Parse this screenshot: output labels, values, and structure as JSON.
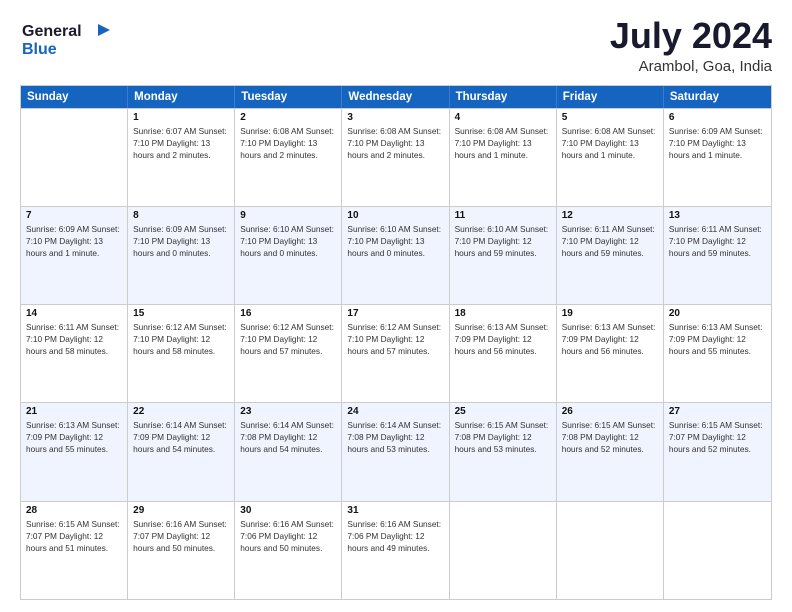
{
  "header": {
    "logo_line1": "General",
    "logo_line2": "Blue",
    "title": "July 2024",
    "subtitle": "Arambol, Goa, India"
  },
  "calendar": {
    "days": [
      "Sunday",
      "Monday",
      "Tuesday",
      "Wednesday",
      "Thursday",
      "Friday",
      "Saturday"
    ],
    "rows": [
      [
        {
          "num": "",
          "info": ""
        },
        {
          "num": "1",
          "info": "Sunrise: 6:07 AM\nSunset: 7:10 PM\nDaylight: 13 hours\nand 2 minutes."
        },
        {
          "num": "2",
          "info": "Sunrise: 6:08 AM\nSunset: 7:10 PM\nDaylight: 13 hours\nand 2 minutes."
        },
        {
          "num": "3",
          "info": "Sunrise: 6:08 AM\nSunset: 7:10 PM\nDaylight: 13 hours\nand 2 minutes."
        },
        {
          "num": "4",
          "info": "Sunrise: 6:08 AM\nSunset: 7:10 PM\nDaylight: 13 hours\nand 1 minute."
        },
        {
          "num": "5",
          "info": "Sunrise: 6:08 AM\nSunset: 7:10 PM\nDaylight: 13 hours\nand 1 minute."
        },
        {
          "num": "6",
          "info": "Sunrise: 6:09 AM\nSunset: 7:10 PM\nDaylight: 13 hours\nand 1 minute."
        }
      ],
      [
        {
          "num": "7",
          "info": "Sunrise: 6:09 AM\nSunset: 7:10 PM\nDaylight: 13 hours\nand 1 minute."
        },
        {
          "num": "8",
          "info": "Sunrise: 6:09 AM\nSunset: 7:10 PM\nDaylight: 13 hours\nand 0 minutes."
        },
        {
          "num": "9",
          "info": "Sunrise: 6:10 AM\nSunset: 7:10 PM\nDaylight: 13 hours\nand 0 minutes."
        },
        {
          "num": "10",
          "info": "Sunrise: 6:10 AM\nSunset: 7:10 PM\nDaylight: 13 hours\nand 0 minutes."
        },
        {
          "num": "11",
          "info": "Sunrise: 6:10 AM\nSunset: 7:10 PM\nDaylight: 12 hours\nand 59 minutes."
        },
        {
          "num": "12",
          "info": "Sunrise: 6:11 AM\nSunset: 7:10 PM\nDaylight: 12 hours\nand 59 minutes."
        },
        {
          "num": "13",
          "info": "Sunrise: 6:11 AM\nSunset: 7:10 PM\nDaylight: 12 hours\nand 59 minutes."
        }
      ],
      [
        {
          "num": "14",
          "info": "Sunrise: 6:11 AM\nSunset: 7:10 PM\nDaylight: 12 hours\nand 58 minutes."
        },
        {
          "num": "15",
          "info": "Sunrise: 6:12 AM\nSunset: 7:10 PM\nDaylight: 12 hours\nand 58 minutes."
        },
        {
          "num": "16",
          "info": "Sunrise: 6:12 AM\nSunset: 7:10 PM\nDaylight: 12 hours\nand 57 minutes."
        },
        {
          "num": "17",
          "info": "Sunrise: 6:12 AM\nSunset: 7:10 PM\nDaylight: 12 hours\nand 57 minutes."
        },
        {
          "num": "18",
          "info": "Sunrise: 6:13 AM\nSunset: 7:09 PM\nDaylight: 12 hours\nand 56 minutes."
        },
        {
          "num": "19",
          "info": "Sunrise: 6:13 AM\nSunset: 7:09 PM\nDaylight: 12 hours\nand 56 minutes."
        },
        {
          "num": "20",
          "info": "Sunrise: 6:13 AM\nSunset: 7:09 PM\nDaylight: 12 hours\nand 55 minutes."
        }
      ],
      [
        {
          "num": "21",
          "info": "Sunrise: 6:13 AM\nSunset: 7:09 PM\nDaylight: 12 hours\nand 55 minutes."
        },
        {
          "num": "22",
          "info": "Sunrise: 6:14 AM\nSunset: 7:09 PM\nDaylight: 12 hours\nand 54 minutes."
        },
        {
          "num": "23",
          "info": "Sunrise: 6:14 AM\nSunset: 7:08 PM\nDaylight: 12 hours\nand 54 minutes."
        },
        {
          "num": "24",
          "info": "Sunrise: 6:14 AM\nSunset: 7:08 PM\nDaylight: 12 hours\nand 53 minutes."
        },
        {
          "num": "25",
          "info": "Sunrise: 6:15 AM\nSunset: 7:08 PM\nDaylight: 12 hours\nand 53 minutes."
        },
        {
          "num": "26",
          "info": "Sunrise: 6:15 AM\nSunset: 7:08 PM\nDaylight: 12 hours\nand 52 minutes."
        },
        {
          "num": "27",
          "info": "Sunrise: 6:15 AM\nSunset: 7:07 PM\nDaylight: 12 hours\nand 52 minutes."
        }
      ],
      [
        {
          "num": "28",
          "info": "Sunrise: 6:15 AM\nSunset: 7:07 PM\nDaylight: 12 hours\nand 51 minutes."
        },
        {
          "num": "29",
          "info": "Sunrise: 6:16 AM\nSunset: 7:07 PM\nDaylight: 12 hours\nand 50 minutes."
        },
        {
          "num": "30",
          "info": "Sunrise: 6:16 AM\nSunset: 7:06 PM\nDaylight: 12 hours\nand 50 minutes."
        },
        {
          "num": "31",
          "info": "Sunrise: 6:16 AM\nSunset: 7:06 PM\nDaylight: 12 hours\nand 49 minutes."
        },
        {
          "num": "",
          "info": ""
        },
        {
          "num": "",
          "info": ""
        },
        {
          "num": "",
          "info": ""
        }
      ]
    ]
  }
}
